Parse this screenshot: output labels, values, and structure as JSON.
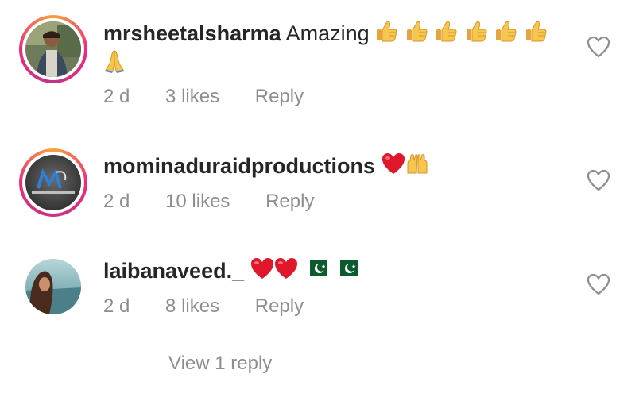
{
  "comments": [
    {
      "username": "mrsheetalsharma",
      "text": "Amazing",
      "emoji_line1": [
        "thumbs-up",
        "thumbs-up",
        "thumbs-up",
        "thumbs-up",
        "thumbs-up",
        "thumbs-up"
      ],
      "emoji_line2": [
        "folded-hands"
      ],
      "time": "2 d",
      "likes": "3 likes",
      "reply": "Reply"
    },
    {
      "username": "mominaduraidproductions",
      "text": "",
      "emoji_line1": [
        "red-heart",
        "raising-hands"
      ],
      "time": "2 d",
      "likes": "10 likes",
      "reply": "Reply"
    },
    {
      "username": "laibanaveed._",
      "text": "",
      "emoji_line1": [
        "red-heart",
        "red-heart",
        "pakistan-flag",
        "pakistan-flag"
      ],
      "time": "2 d",
      "likes": "8 likes",
      "reply": "Reply"
    }
  ],
  "view_replies": "View 1 reply",
  "colors": {
    "text": "#262626",
    "meta": "#8e8e8e",
    "ring_start": "#f9a23b",
    "ring_end": "#c13584"
  },
  "icons": [
    "heart-outline-icon"
  ]
}
